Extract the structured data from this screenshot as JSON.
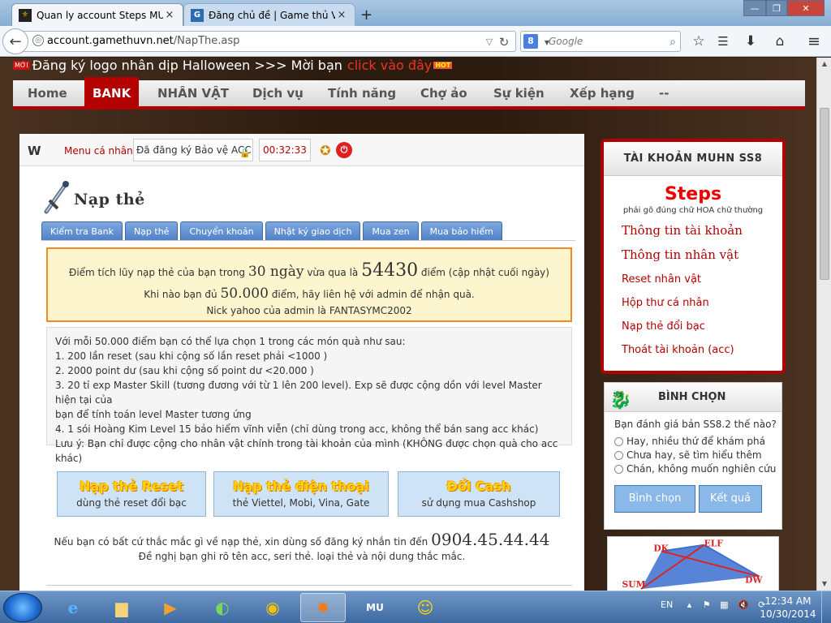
{
  "browser": {
    "tabs": [
      {
        "title": "Quan ly account Steps MU ...",
        "active": true
      },
      {
        "title": "Đăng chủ đề | Game thủ Vi...",
        "active": false
      }
    ],
    "new_tab": "+",
    "url_domain": "account.gamethuvn.net",
    "url_path": "/NapThe.asp",
    "search_placeholder": "Google",
    "search_engine_letter": "8",
    "window_min": "—",
    "window_max": "❐",
    "window_close": "✕"
  },
  "page": {
    "banner": {
      "new_badge": "MỚI",
      "text": "Đăng ký logo nhân dịp Halloween >>> Mời bạn",
      "link": "click vào đây",
      "hot_badge": "HOT"
    },
    "menu": [
      "Home",
      "BANK",
      "NHÂN VẬT",
      "Dịch vụ",
      "Tính năng",
      "Chợ ảo",
      "Sự kiện",
      "Xếp hạng",
      "--"
    ],
    "active_menu": "BANK",
    "topstrip": {
      "logo": "W",
      "menu_label": "Menu cá nhân",
      "security_text": "Đã đăng ký Bảo vệ ACC",
      "timer": "00:32:33"
    },
    "section_title": "Nạp thẻ",
    "subtabs": [
      "Kiểm tra Bank",
      "Nạp thẻ",
      "Chuyển khoản",
      "Nhật ký giao dịch",
      "Mua zen",
      "Mua bảo hiểm"
    ],
    "notice": {
      "l1_a": "Điểm tích lũy nạp thẻ của bạn trong",
      "days": "30 ngày",
      "l1_b": "vừa qua là",
      "points": "54430",
      "l1_c": "điểm (cập nhật cuối ngày)",
      "l2_a": "Khi nào bạn đủ",
      "target": "50.000",
      "l2_b": "điểm, hãy liên hệ với admin để nhận quà.",
      "l3": "Nick yahoo của admin là FANTASYMC2002"
    },
    "gifts": [
      "Với mỗi 50.000 điểm bạn có thể lựa chọn 1 trong các món quà như sau:",
      "1. 200 lần reset (sau khi cộng số lần reset phải <1000 )",
      "2. 2000 point dư (sau khi cộng số point dư <20.000 )",
      "3. 20 tỉ exp Master Skill (tương đương với từ 1 lên 200 level). Exp sẽ được cộng dồn với level Master hiện tại của",
      "bạn để tính toán level Master tương ứng",
      "4. 1 sói Hoàng Kim Level 15 bảo hiểm vĩnh viễn (chỉ dùng trong acc, không thể bán sang acc khác)",
      "Lưu ý: Bạn chỉ được cộng cho nhân vật chính trong tài khoản của mình (KHÔNG được chọn quà cho acc khác)"
    ],
    "buttons": [
      {
        "title": "Nạp thẻ Reset",
        "sub": "dùng thẻ reset đổi bạc"
      },
      {
        "title": "Nạp thẻ điện thoại",
        "sub": "thẻ Viettel, Mobi, Vina, Gate"
      },
      {
        "title": "Đổi Cash",
        "sub": "sử dụng mua Cashshop"
      }
    ],
    "footer": {
      "l1": "Nếu bạn có bất cứ thắc mắc gì về nạp thẻ, xin dùng số đăng ký nhắn tin đến",
      "phone": "0904.45.44.44",
      "l2": "Đề nghị bạn ghi rõ tên acc, seri thẻ. loại thẻ và nội dung thắc mắc."
    },
    "sidebar": {
      "account_header": "TÀI KHOẢN MUHN SS8",
      "username": "Steps",
      "username_note": "phải gõ đúng chữ HOA chữ thường",
      "links": [
        "Thông tin tài khoản",
        "Thông tin nhân vật",
        "Reset nhân vật",
        "Hộp thư cá nhân",
        "Nạp thẻ đổi bạc",
        "Thoát tài khoản (acc)"
      ],
      "vote_header": "BÌNH CHỌN",
      "vote_question": "Bạn đánh giá bản SS8.2 thế nào?",
      "vote_options": [
        "Hay, nhiều thứ để khám phá",
        "Chưa hay, sẽ tìm hiểu thêm",
        "Chán, không muốn nghiên cứu"
      ],
      "vote_button": "Bình chọn",
      "result_button": "Kết quả",
      "diagram_labels": [
        "DK",
        "ELF",
        "SUM",
        "DW"
      ]
    }
  },
  "taskbar": {
    "lang": "EN",
    "time": "12:34 AM",
    "date": "10/30/2014",
    "icon_labels": {
      "mu": "MU"
    }
  },
  "colors": {
    "accent_red": "#b30000",
    "notice_bg": "#fdf5ce",
    "notice_border": "#f08a24",
    "tab_blue": "#4f7fc7"
  }
}
